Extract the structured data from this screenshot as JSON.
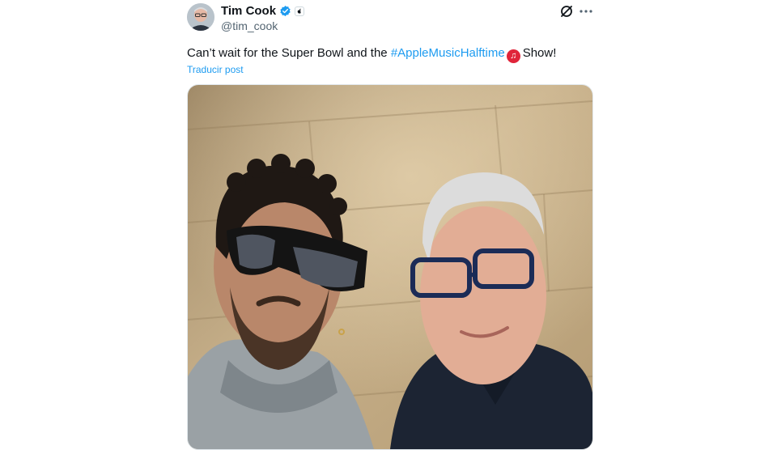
{
  "post": {
    "author_name": "Tim Cook",
    "author_handle": "@tim_cook",
    "text_before": "Can’t wait for the Super Bowl and the ",
    "hashtag": "#AppleMusicHalftime",
    "emoji_glyph": "♫",
    "text_after": "Show!",
    "translate_label": "Traducir post"
  },
  "icons": {
    "verified": "verified-badge-icon",
    "affiliate": "apple-affiliate-icon",
    "grok": "grok-icon",
    "more": "more-options-icon",
    "emoji": "music-note-icon"
  },
  "colors": {
    "text": "#0f1419",
    "secondary": "#536471",
    "link": "#1d9bf0",
    "emoji_red": "#e0243a"
  }
}
